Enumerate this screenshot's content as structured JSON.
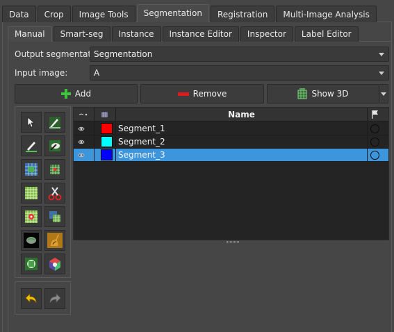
{
  "top_tabs": [
    "Data",
    "Crop",
    "Image Tools",
    "Segmentation",
    "Registration",
    "Multi-Image Analysis"
  ],
  "sub_tabs": [
    "Manual",
    "Smart-seg",
    "Instance",
    "Instance Editor",
    "Inspector",
    "Label Editor"
  ],
  "output_segmentation": {
    "label": "Output segmentation:",
    "value": "Segmentation"
  },
  "input_image": {
    "label": "Input image:",
    "value": "A"
  },
  "buttons": {
    "add": "Add",
    "remove": "Remove",
    "show3d": "Show 3D"
  },
  "table": {
    "header_name": "Name",
    "rows": [
      {
        "name": "Segment_1",
        "color": "#ff0000",
        "selected": false
      },
      {
        "name": "Segment_2",
        "color": "#00ffff",
        "selected": false
      },
      {
        "name": "Segment_3",
        "color": "#0000ff",
        "selected": true
      }
    ]
  },
  "tools": [
    "pointer-tool-icon",
    "paint-tool-icon",
    "draw-tool-icon",
    "erase-tool-icon",
    "threshold-tool-icon",
    "grow-tool-icon",
    "grid-tool-icon",
    "scissors-tool-icon",
    "seed-tool-icon",
    "fill-tool-icon",
    "smooth-tool-icon",
    "texture-tool-icon",
    "islands-tool-icon",
    "logical-tool-icon"
  ],
  "history": [
    "undo-icon",
    "redo-icon"
  ],
  "colors": {
    "selection": "#3d95dc",
    "add_icon": "#3cc43c",
    "remove_icon": "#e01b1b"
  }
}
